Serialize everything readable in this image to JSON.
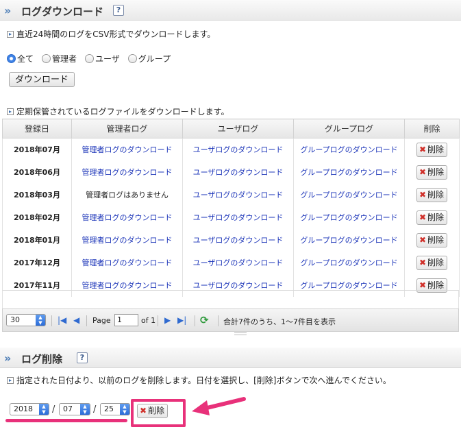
{
  "download_section": {
    "title": "ログダウンロード",
    "help": "?",
    "note1": "直近24時間のログをCSV形式でダウンロードします。",
    "radio_all": "全て",
    "radio_admin": "管理者",
    "radio_user": "ユーザ",
    "radio_group": "グループ",
    "download_button": "ダウンロード",
    "note2": "定期保管されているログファイルをダウンロードします。"
  },
  "table": {
    "headers": [
      "登録日",
      "管理者ログ",
      "ユーザログ",
      "グループログ",
      "削除"
    ],
    "rows": [
      {
        "date": "2018年07月",
        "admin": "管理者ログのダウンロード",
        "user": "ユーザログのダウンロード",
        "group": "グループログのダウンロード",
        "delete": "削除"
      },
      {
        "date": "2018年06月",
        "admin": "管理者ログのダウンロード",
        "user": "ユーザログのダウンロード",
        "group": "グループログのダウンロード",
        "delete": "削除"
      },
      {
        "date": "2018年03月",
        "admin": "管理者ログはありません",
        "user": "ユーザログのダウンロード",
        "group": "グループログのダウンロード",
        "delete": "削除"
      },
      {
        "date": "2018年02月",
        "admin": "管理者ログのダウンロード",
        "user": "ユーザログのダウンロード",
        "group": "グループログのダウンロード",
        "delete": "削除"
      },
      {
        "date": "2018年01月",
        "admin": "管理者ログのダウンロード",
        "user": "ユーザログのダウンロード",
        "group": "グループログのダウンロード",
        "delete": "削除"
      },
      {
        "date": "2017年12月",
        "admin": "管理者ログのダウンロード",
        "user": "ユーザログのダウンロード",
        "group": "グループログのダウンロード",
        "delete": "削除"
      },
      {
        "date": "2017年11月",
        "admin": "管理者ログのダウンロード",
        "user": "ユーザログのダウンロード",
        "group": "グループログのダウンロード",
        "delete": "削除"
      }
    ]
  },
  "pager": {
    "page_size": "30",
    "page_label": "Page",
    "page_value": "1",
    "of_label": "of 1",
    "summary": "合計7件のうち、1〜7件目を表示"
  },
  "delete_section": {
    "title": "ログ削除",
    "help": "?",
    "note": "指定された日付より、以前のログを削除します。日付を選択し、[削除]ボタンで次へ進んでください。",
    "year": "2018",
    "month": "07",
    "day": "25",
    "separator": "/",
    "delete_button": "削除"
  },
  "colors": {
    "accent": "#e8317a",
    "link": "#1a33b8"
  }
}
